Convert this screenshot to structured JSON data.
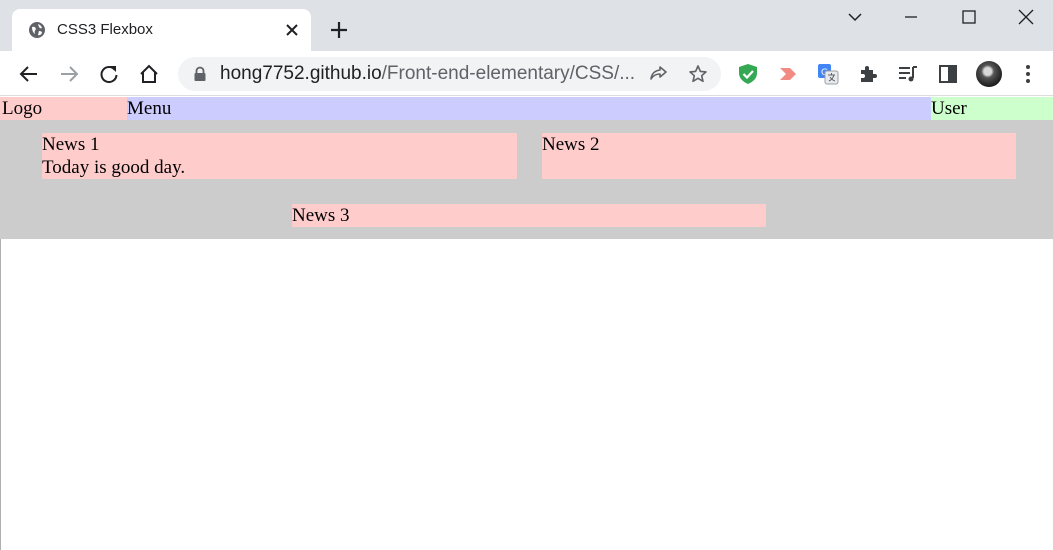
{
  "browser": {
    "tab": {
      "title": "CSS3 Flexbox"
    },
    "address": {
      "host": "hong7752.github.io",
      "path": "/Front-end-elementary/CSS/..."
    }
  },
  "page": {
    "header": {
      "logo": "Logo",
      "menu": "Menu",
      "user": "User"
    },
    "news": [
      {
        "title": "News 1",
        "body": "Today is good day."
      },
      {
        "title": "News 2"
      },
      {
        "title": "News 3"
      }
    ]
  },
  "colors": {
    "logo_bg": "#ffcccc",
    "menu_bg": "#ccccff",
    "user_bg": "#ccffcc",
    "news_area_bg": "#cccccc",
    "news_bg": "#ffcccc"
  }
}
